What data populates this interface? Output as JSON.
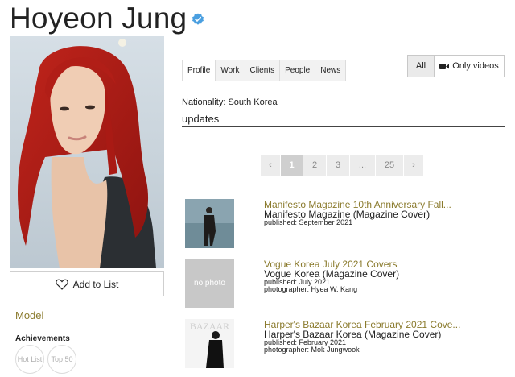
{
  "profile": {
    "name": "Hoyeon Jung",
    "add_to_list": "Add to List",
    "category": "Model",
    "achievements_title": "Achievements",
    "achievements": [
      "Hot List",
      "Top 50"
    ],
    "nationality": "Nationality: South Korea"
  },
  "tabs": [
    "Profile",
    "Work",
    "Clients",
    "People",
    "News"
  ],
  "filters": {
    "all": "All",
    "videos": "Only videos"
  },
  "updates_title": "updates",
  "pagination": {
    "prev": "‹",
    "pages": [
      "1",
      "2",
      "3",
      "...",
      "25"
    ],
    "next": "›",
    "current": "1"
  },
  "items": [
    {
      "title": "Manifesto Magazine 10th Anniversary Fall...",
      "subtitle": "Manifesto Magazine (Magazine Cover)",
      "published": "published: September 2021",
      "photographer": ""
    },
    {
      "title": "Vogue Korea July 2021 Covers",
      "subtitle": "Vogue Korea (Magazine Cover)",
      "published": "published: July 2021",
      "photographer": "photographer: Hyea W. Kang",
      "thumb_text": "no photo"
    },
    {
      "title": "Harper's Bazaar Korea February 2021 Cove...",
      "subtitle": "Harper's Bazaar Korea (Magazine Cover)",
      "published": "published: February 2021",
      "photographer": "photographer: Mok Jungwook",
      "thumb_text": "BAZAAR"
    }
  ],
  "colors": {
    "accent": "#8a7a2c",
    "verified": "#4a9fe0"
  },
  "icons": {
    "verified": "verified-badge-icon",
    "heart": "heart-icon",
    "video": "video-camera-icon"
  }
}
